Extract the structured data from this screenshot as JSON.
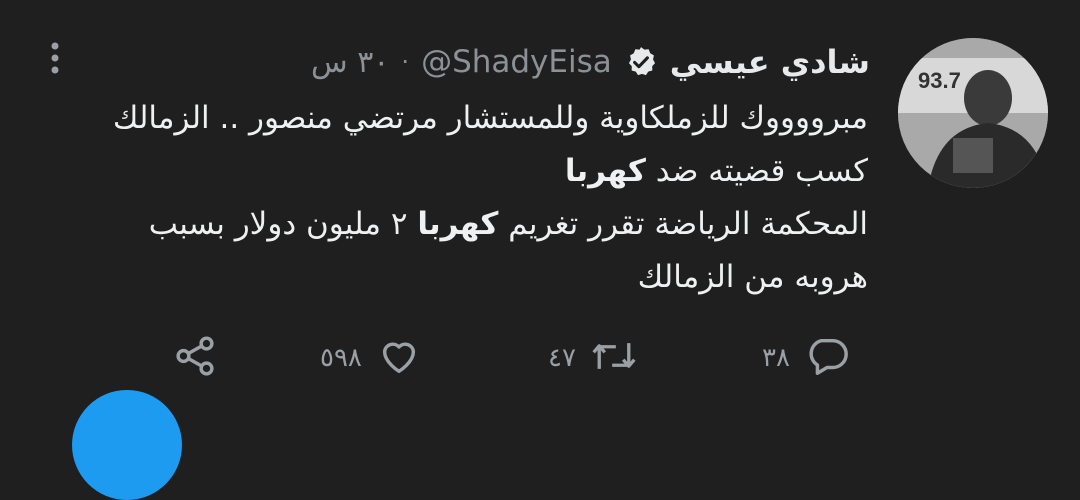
{
  "tweet": {
    "display_name": "شادي عيسي",
    "handle": "@ShadyEisa",
    "time": "٣٠ س",
    "separator": "·",
    "body": {
      "line1": "مبرووووك للزملكاوية وللمستشار مرتضي منصور .. الزمالك",
      "line2_pre": "كسب قضيته ضد ",
      "line2_bold": "كهربا",
      "line3_pre": "المحكمة الرياضة تقرر تغريم ",
      "line3_bold": "كهربا",
      "line3_post": " ٢ مليون دولار بسبب",
      "line4": "هروبه من الزمالك"
    },
    "actions": {
      "replies": "٣٨",
      "retweets": "٤٧",
      "likes": "٥٩٨"
    },
    "avatar_text": "93.7"
  },
  "colors": {
    "background": "#1f1f1f",
    "text": "#e7e9ea",
    "muted": "#8b9196",
    "verified": "#1d9bf0"
  },
  "icons": [
    "more-vertical-icon",
    "verified-badge-icon",
    "reply-icon",
    "retweet-icon",
    "like-icon",
    "share-icon"
  ]
}
